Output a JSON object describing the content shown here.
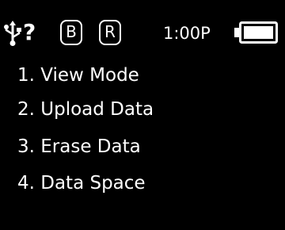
{
  "status_bar": {
    "unknown_glyph": "?",
    "box_b_label": "B",
    "box_r_label": "R",
    "time": "1:00P",
    "usb_icon": "usb-icon",
    "battery_icon": "battery-icon",
    "battery_level": 1.0
  },
  "menu": {
    "items": [
      {
        "label": "1. View Mode"
      },
      {
        "label": "2. Upload Data"
      },
      {
        "label": "3. Erase Data"
      },
      {
        "label": "4. Data Space"
      }
    ]
  },
  "colors": {
    "background": "#000000",
    "foreground": "#ffffff"
  }
}
